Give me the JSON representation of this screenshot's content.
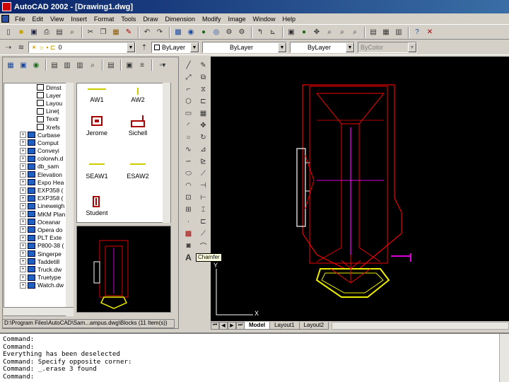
{
  "window": {
    "title": "AutoCAD 2002 - [Drawing1.dwg]"
  },
  "menu": [
    "File",
    "Edit",
    "View",
    "Insert",
    "Format",
    "Tools",
    "Draw",
    "Dimension",
    "Modify",
    "Image",
    "Window",
    "Help"
  ],
  "properties": {
    "layer": "0",
    "color": "ByLayer",
    "linetype": "ByLayer",
    "lineweight": "ByLayer",
    "plotstyle": "ByColor"
  },
  "tree": {
    "items": [
      {
        "label": "Dimst",
        "type": "leaf"
      },
      {
        "label": "Layer",
        "type": "leaf"
      },
      {
        "label": "Layou",
        "type": "leaf"
      },
      {
        "label": "Lineţ",
        "type": "leaf"
      },
      {
        "label": "Textr",
        "type": "leaf"
      },
      {
        "label": "Xrefs",
        "type": "leaf"
      },
      {
        "label": "Curbase",
        "type": "folder"
      },
      {
        "label": "Comput",
        "type": "folder"
      },
      {
        "label": "Conveyi",
        "type": "folder"
      },
      {
        "label": "colorwh.d",
        "type": "folder"
      },
      {
        "label": "db_sam",
        "type": "folder"
      },
      {
        "label": "Elevation",
        "type": "folder"
      },
      {
        "label": "Expo Hea",
        "type": "folder"
      },
      {
        "label": "EXP358 (",
        "type": "folder"
      },
      {
        "label": "EXP358 (",
        "type": "folder"
      },
      {
        "label": "Lineweigh",
        "type": "folder"
      },
      {
        "label": "MKM Plan",
        "type": "folder"
      },
      {
        "label": "Oceanar",
        "type": "folder"
      },
      {
        "label": "Opera do",
        "type": "folder"
      },
      {
        "label": "PLT Exte",
        "type": "folder"
      },
      {
        "label": "P800-38 (",
        "type": "folder"
      },
      {
        "label": "Singerpe",
        "type": "folder"
      },
      {
        "label": "Taddetill",
        "type": "folder"
      },
      {
        "label": "Truck.dw",
        "type": "folder"
      },
      {
        "label": "Truetype",
        "type": "folder"
      },
      {
        "label": "Watch.dw",
        "type": "folder"
      }
    ]
  },
  "blocks": [
    "AW1",
    "AW2",
    "Jerome",
    "Sichell",
    "SEAW1",
    "ESAW2",
    "Student"
  ],
  "path_bar": "D:\\Program Files\\AutoCAD\\Sam...ampus.dwg\\Blocks (11 Item(s))",
  "layout_tabs": [
    "Model",
    "Layout1",
    "Layout2"
  ],
  "tooltip": "Chamfer",
  "ucs": {
    "x_label": "X",
    "y_label": "Y"
  },
  "command_lines": [
    "Command:",
    "Command:",
    "Everything has been deselected",
    "Command: Specify opposite corner:",
    "Command: _.erase 3 found",
    "Command:"
  ]
}
